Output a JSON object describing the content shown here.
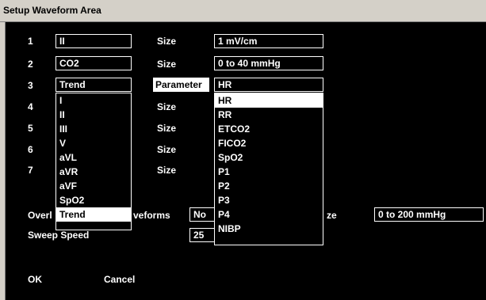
{
  "window": {
    "title": "Setup Waveform Area"
  },
  "rows": [
    {
      "num": "1",
      "value": "II",
      "prop_label": "Size",
      "prop_value": "1 mV/cm"
    },
    {
      "num": "2",
      "value": "CO2",
      "prop_label": "Size",
      "prop_value": "0 to 40 mmHg"
    },
    {
      "num": "3",
      "value": "Trend",
      "prop_label": "Parameter",
      "prop_value": "HR"
    },
    {
      "num": "4",
      "prop_label": "Size"
    },
    {
      "num": "5",
      "prop_label": "Size"
    },
    {
      "num": "6",
      "prop_label": "Size"
    },
    {
      "num": "7",
      "prop_label": "Size"
    }
  ],
  "overlay": {
    "label_left": "Overl",
    "label_right": "veforms",
    "value": "No",
    "size_label": "ze",
    "size_value": "0 to 200 mmHg"
  },
  "sweep": {
    "label": "Sweep Speed",
    "value": "25"
  },
  "buttons": {
    "ok": "OK",
    "cancel": "Cancel"
  },
  "waveform_dropdown": {
    "options": [
      "I",
      "II",
      "III",
      "V",
      "aVL",
      "aVR",
      "aVF",
      "SpO2",
      "Trend"
    ],
    "highlighted": "Trend"
  },
  "parameter_dropdown": {
    "options": [
      "HR",
      "RR",
      "ETCO2",
      "FICO2",
      "SpO2",
      "P1",
      "P2",
      "P3",
      "P4",
      "NIBP"
    ],
    "highlighted": "HR"
  }
}
